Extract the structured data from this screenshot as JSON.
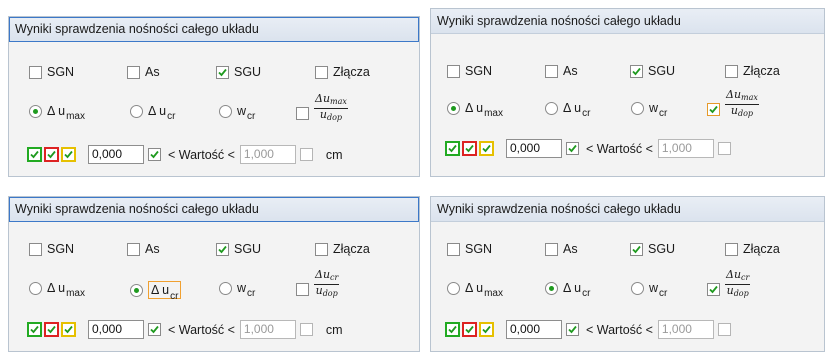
{
  "panels": [
    {
      "title": "Wyniki sprawdzenia nośności całego układu"
    },
    {
      "title": "Wyniki sprawdzenia nośności całego układu"
    },
    {
      "title": "Wyniki sprawdzenia nośności całego układu"
    },
    {
      "title": "Wyniki sprawdzenia nośności całego układu"
    }
  ],
  "labels": {
    "sgn": "SGN",
    "as": "As",
    "sgu": "SGU",
    "zlacza": "Złącza",
    "delta": "Δ u",
    "max": "max",
    "cr": "cr",
    "w": "w",
    "dop": "dop",
    "value_min": "0,000",
    "value_max": "1,000",
    "wartosc": "< Wartość <",
    "unit": "cm"
  },
  "colors": {
    "check_green": "#22aa22",
    "check_red": "#dd2222",
    "check_yellow": "#e6c000",
    "radio_dot": "#1f9a1f"
  }
}
